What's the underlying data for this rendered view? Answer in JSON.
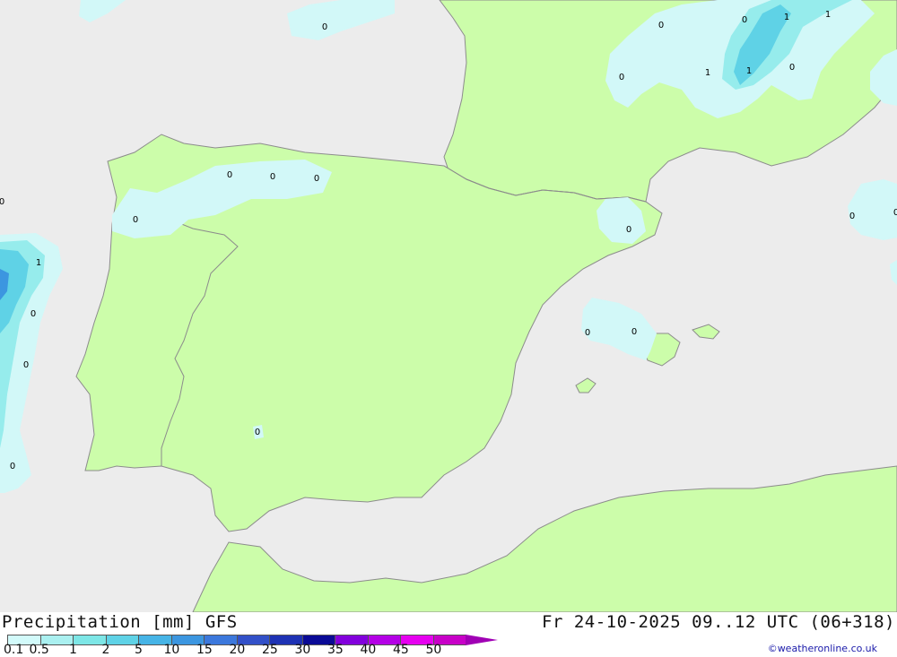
{
  "map": {
    "colors": {
      "sea": "#ececec",
      "land": "#ccfdaa",
      "coast": "#8c8c8c",
      "precip_light": "#d2f8f8",
      "precip_mid": "#96ecec",
      "precip_strong": "#5fd2e6",
      "precip_heavy": "#3c96e0"
    },
    "labels": [
      {
        "id": "v1",
        "text": "0"
      },
      {
        "id": "v2",
        "text": "0"
      },
      {
        "id": "v3",
        "text": "0"
      },
      {
        "id": "v4",
        "text": "1"
      },
      {
        "id": "v5",
        "text": "1"
      },
      {
        "id": "v6",
        "text": "0"
      },
      {
        "id": "v7",
        "text": "1"
      },
      {
        "id": "v8",
        "text": "1"
      },
      {
        "id": "v9",
        "text": "0"
      },
      {
        "id": "v10",
        "text": "0"
      },
      {
        "id": "v11",
        "text": "0"
      },
      {
        "id": "v12",
        "text": "0"
      },
      {
        "id": "v13",
        "text": "0"
      },
      {
        "id": "v14",
        "text": "0"
      },
      {
        "id": "v15",
        "text": "0"
      },
      {
        "id": "v16",
        "text": "0"
      },
      {
        "id": "v17",
        "text": "0"
      },
      {
        "id": "v18",
        "text": "0"
      },
      {
        "id": "v19",
        "text": "0"
      },
      {
        "id": "v20",
        "text": "0"
      },
      {
        "id": "v21",
        "text": "1"
      },
      {
        "id": "v22",
        "text": "0"
      },
      {
        "id": "v23",
        "text": "0"
      },
      {
        "id": "v24",
        "text": "0"
      }
    ]
  },
  "footer": {
    "title": "Precipitation [mm] GFS",
    "datetime": "Fr 24-10-2025 09..12 UTC (06+318)",
    "credit": "©weatheronline.co.uk"
  },
  "legend": {
    "ticks": [
      "0.1",
      "0.5",
      "1",
      "2",
      "5",
      "10",
      "15",
      "20",
      "25",
      "30",
      "35",
      "40",
      "45",
      "50"
    ],
    "colors": [
      "#d2fafa",
      "#aaf0f0",
      "#7de6e6",
      "#5fd2e6",
      "#46b4e6",
      "#3c96e0",
      "#3c78dc",
      "#3250c8",
      "#1e32b4",
      "#0a0a96",
      "#8200dc",
      "#b400e6",
      "#e600f0",
      "#c800c8",
      "#a000b4"
    ]
  }
}
